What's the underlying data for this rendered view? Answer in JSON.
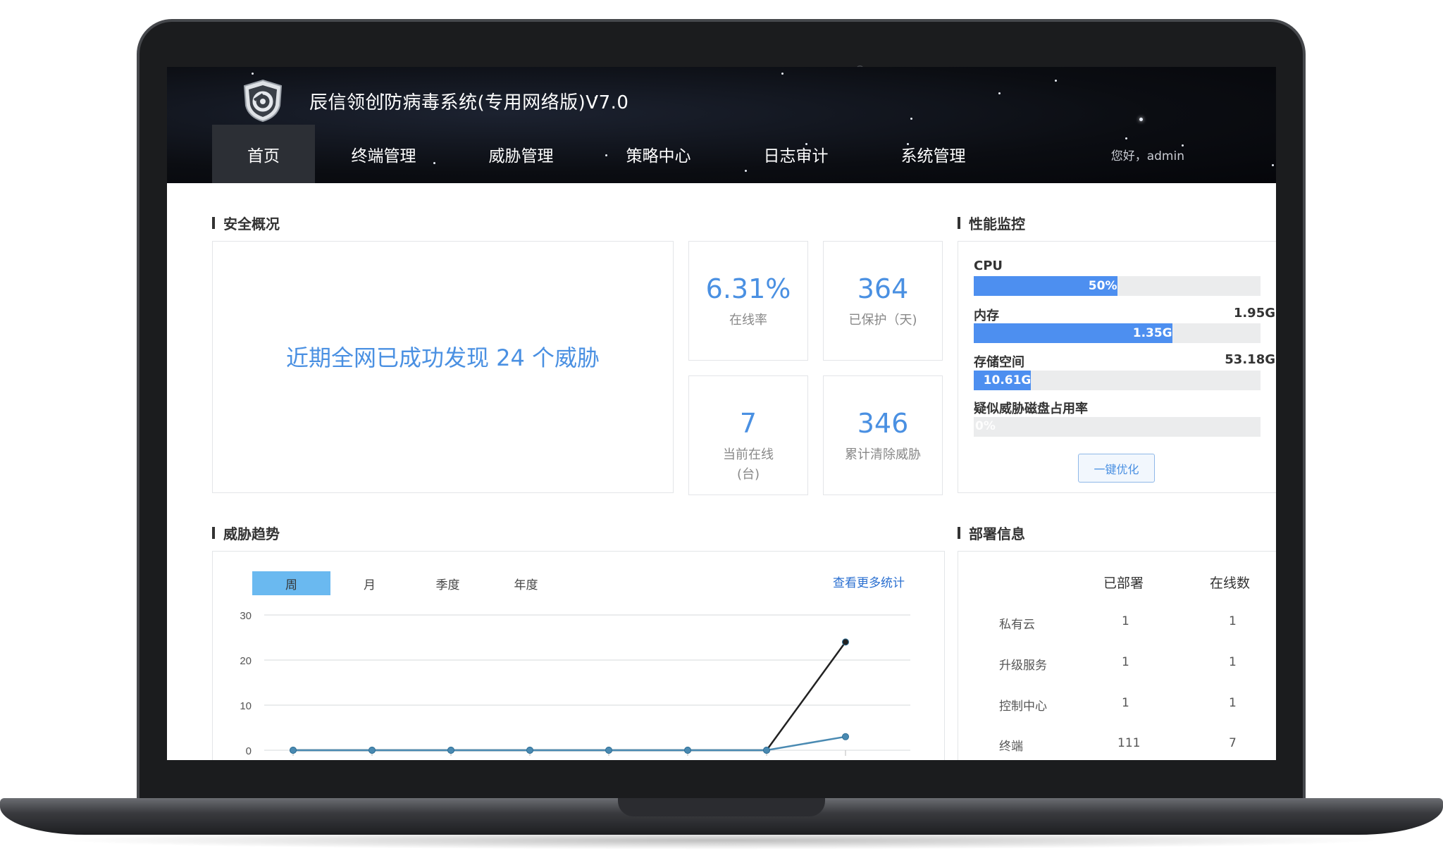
{
  "app": {
    "title": "辰信领创防病毒系统(专用网络版)V7.0",
    "greeting": "您好，admin"
  },
  "nav": {
    "items": [
      "首页",
      "终端管理",
      "威胁管理",
      "策略中心",
      "日志审计",
      "系统管理"
    ],
    "active": "首页"
  },
  "overview": {
    "title": "安全概况",
    "message": "近期全网已成功发现 24 个威胁",
    "cards": [
      {
        "value": "6.31%",
        "label": "在线率"
      },
      {
        "value": "364",
        "label": "已保护（天)"
      },
      {
        "value": "7",
        "label": "当前在线\n(台)"
      },
      {
        "value": "346",
        "label": "累计清除威胁"
      }
    ]
  },
  "perf": {
    "title": "性能监控",
    "cpu": {
      "label": "CPU",
      "percent": 50,
      "text": "50%"
    },
    "memory": {
      "label": "内存",
      "total": "1.95G",
      "used": "1.35G",
      "fraction": 0.692
    },
    "storage": {
      "label": "存储空间",
      "total": "53.18G",
      "used": "10.61G",
      "fraction": 0.2
    },
    "threat_disk": {
      "label": "疑似威胁磁盘占用率",
      "text": "0%",
      "percent": 0
    },
    "optimize_button": "一键优化"
  },
  "trend": {
    "title": "威胁趋势",
    "tabs": [
      "周",
      "月",
      "季度",
      "年度"
    ],
    "active_tab": "周",
    "more_link": "查看更多统计"
  },
  "chart_data": {
    "type": "line",
    "x": [
      1,
      2,
      3,
      4,
      5,
      6,
      7,
      8
    ],
    "ylim": [
      0,
      30
    ],
    "yticks": [
      "0",
      "10",
      "20",
      "30"
    ],
    "series": [
      {
        "values": [
          0,
          0,
          0,
          0,
          0,
          0,
          0,
          24
        ],
        "color": "#222222"
      },
      {
        "values": [
          0,
          0,
          0,
          0,
          0,
          0,
          0,
          3
        ],
        "color": "#4a8ab2"
      }
    ],
    "grid": true
  },
  "deploy": {
    "title": "部署信息",
    "columns": [
      "已部署",
      "在线数"
    ],
    "rows": [
      {
        "name": "私有云",
        "deployed": "1",
        "online": "1"
      },
      {
        "name": "升级服务",
        "deployed": "1",
        "online": "1"
      },
      {
        "name": "控制中心",
        "deployed": "1",
        "online": "1"
      },
      {
        "name": "终端",
        "deployed": "111",
        "online": "7"
      }
    ]
  },
  "colors": {
    "accent": "#4a90e2",
    "bar": "#4d8ff0",
    "header_bg": "#0b0d12",
    "tab_active": "#6ab9f0"
  }
}
